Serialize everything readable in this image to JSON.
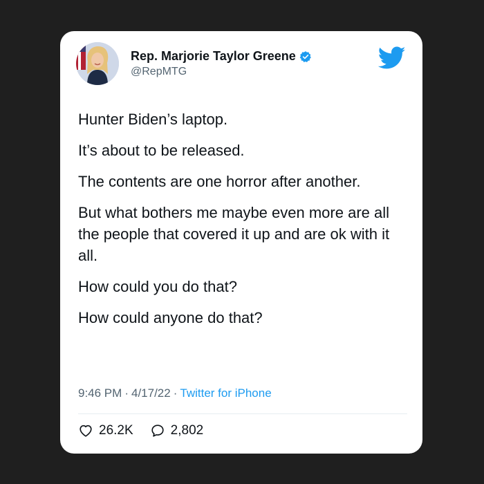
{
  "author": {
    "display_name": "Rep. Marjorie Taylor Greene",
    "handle": "@RepMTG",
    "verified": true,
    "avatar_icon": "profile-photo"
  },
  "brand": {
    "logo_icon": "twitter-bird-icon",
    "accent_color": "#1d9bf0"
  },
  "tweet": {
    "lines": [
      "Hunter Biden’s laptop.",
      "It’s about to be released.",
      "The contents are one horror after another.",
      "But what bothers me maybe even more are all the people that covered it up and are ok with it all.",
      "How could you do that?",
      "How could anyone do that?"
    ]
  },
  "meta": {
    "time": "9:46 PM",
    "separator": "·",
    "date": "4/17/22",
    "source": "Twitter for iPhone"
  },
  "stats": {
    "likes": "26.2K",
    "replies": "2,802"
  }
}
